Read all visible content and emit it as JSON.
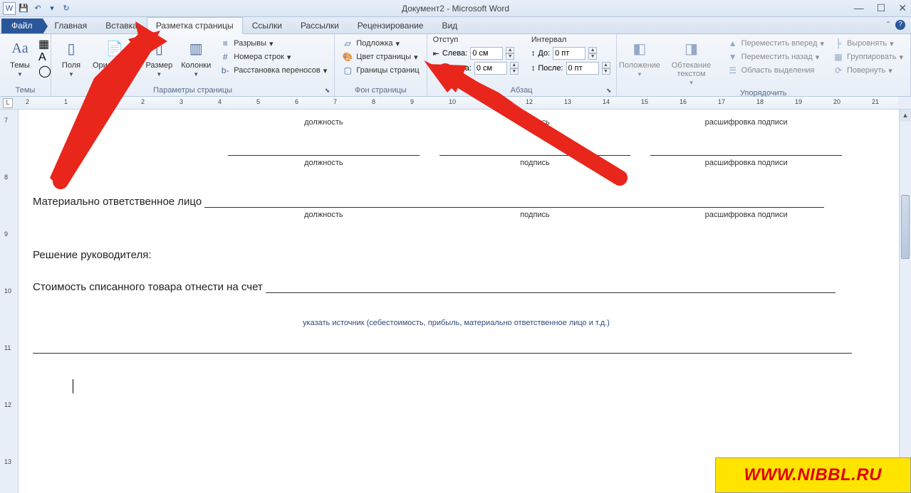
{
  "title": "Документ2 - Microsoft Word",
  "qa": {
    "word": "W"
  },
  "tabs": {
    "file": "Файл",
    "home": "Главная",
    "insert": "Вставка",
    "layout": "Разметка страницы",
    "references": "Ссылки",
    "mailings": "Рассылки",
    "review": "Рецензирование",
    "view": "Вид"
  },
  "ribbon": {
    "themes": {
      "label": "Темы",
      "group": "Темы"
    },
    "pagesetup": {
      "margins": "Поля",
      "orientation": "Ориентация",
      "size": "Размер",
      "columns": "Колонки",
      "breaks": "Разрывы",
      "linenumbers": "Номера строк",
      "hyphenation": "Расстановка переносов",
      "group": "Параметры страницы"
    },
    "pagebg": {
      "watermark": "Подложка",
      "color": "Цвет страницы",
      "borders": "Границы страниц",
      "group": "Фон страницы"
    },
    "indent": {
      "title": "Отступ",
      "left": "Слева:",
      "right": "Справа:",
      "leftval": "0 см",
      "rightval": "0 см"
    },
    "spacing": {
      "title": "Интервал",
      "before": "До:",
      "after": "После:",
      "beforeval": "0 пт",
      "afterval": "0 пт"
    },
    "paragraph": "Абзац",
    "arrange": {
      "position": "Положение",
      "wrap": "Обтекание текстом",
      "forward": "Переместить вперед",
      "backward": "Переместить назад",
      "selection": "Область выделения",
      "align": "Выровнять",
      "group_btn": "Группировать",
      "rotate": "Повернуть",
      "group": "Упорядочить"
    }
  },
  "doc": {
    "dolzhnost": "должность",
    "podpis": "подпись",
    "rasshifrovka": "расшифровка подписи",
    "matline": "Материально ответственное лицо",
    "decision": "Решение руководителя:",
    "stoimost": "Стоимость списанного товара отнести на счет",
    "source": "указать источник (себестоимость, прибыль, материально ответственное лицо и т.д.)"
  },
  "badge": "WWW.NIBBL.RU",
  "vruler": [
    "7",
    "8",
    "9",
    "10",
    "11",
    "12",
    "13"
  ],
  "hruler": [
    "2",
    "1",
    "1",
    "2",
    "3",
    "4",
    "5",
    "6",
    "7",
    "8",
    "9",
    "10",
    "11",
    "12",
    "13",
    "14",
    "15",
    "16",
    "17",
    "18",
    "19",
    "20",
    "21"
  ]
}
